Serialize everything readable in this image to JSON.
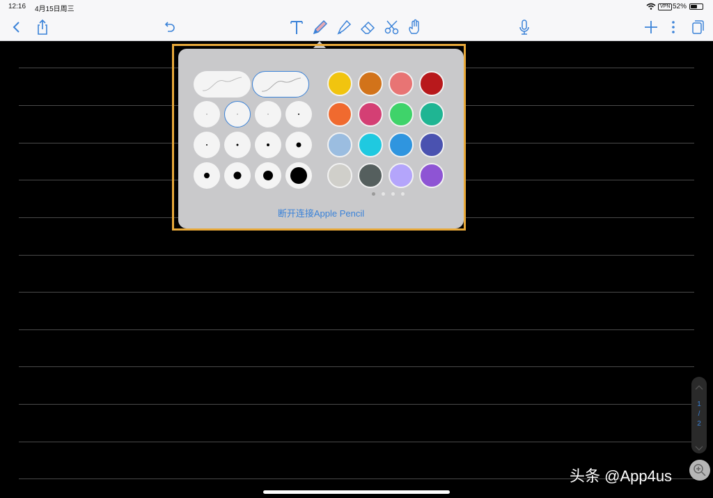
{
  "status_bar": {
    "time": "12:16",
    "date": "4月15日周三",
    "vpn": "VPN",
    "battery": "52%"
  },
  "toolbar": {
    "left_icons": [
      "back-chevron-icon",
      "share-icon",
      "undo-icon"
    ],
    "center_icons": [
      "text-tool-icon",
      "pen-tool-icon",
      "highlighter-tool-icon",
      "eraser-tool-icon",
      "lasso-scissors-icon",
      "hand-tool-icon"
    ],
    "right_icons": [
      "microphone-icon",
      "add-icon",
      "more-icon",
      "pages-icon"
    ],
    "active_tool": "pen-tool-icon",
    "accent": "#3a82d8"
  },
  "pen_popover": {
    "stroke_styles": [
      {
        "name": "fountain",
        "selected": false
      },
      {
        "name": "ball",
        "selected": true
      }
    ],
    "sizes": [
      {
        "dot": 1,
        "selected": false
      },
      {
        "dot": 1,
        "selected": true
      },
      {
        "dot": 1,
        "selected": false
      },
      {
        "dot": 2,
        "selected": false
      },
      {
        "dot": 2,
        "selected": false
      },
      {
        "dot": 3,
        "selected": false
      },
      {
        "dot": 4,
        "selected": false
      },
      {
        "dot": 7,
        "selected": false
      },
      {
        "dot": 8,
        "selected": false
      },
      {
        "dot": 11,
        "selected": false
      },
      {
        "dot": 14,
        "selected": false
      },
      {
        "dot": 24,
        "selected": false
      }
    ],
    "colors": [
      "#f1c40f",
      "#d2731a",
      "#e87474",
      "#b8191c",
      "#f06a2f",
      "#d43f74",
      "#3fd36a",
      "#1fb593",
      "#9bbde0",
      "#1fc9e0",
      "#2f95df",
      "#4a52b0",
      "#d0cfca",
      "#555f5e",
      "#b4a5fb",
      "#8e54d4"
    ],
    "pager": {
      "count": 4,
      "current": 0
    },
    "disconnect_label": "断开连接Apple Pencil"
  },
  "page_scroller": {
    "current": "1",
    "separator": "/",
    "total": "2"
  },
  "watermark": "头条 @App4us"
}
